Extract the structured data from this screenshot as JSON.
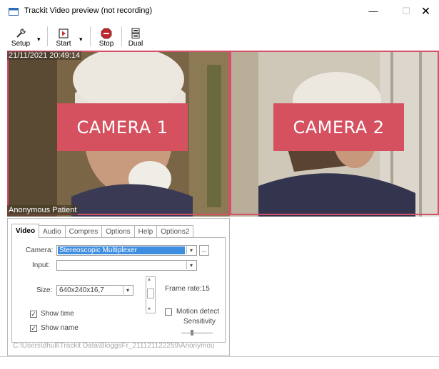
{
  "window": {
    "title": "Trackit Video preview (not recording)",
    "minimize_glyph": "—",
    "maximize_glyph": "☐",
    "close_glyph": "✕"
  },
  "toolbar": {
    "setup_label": "Setup",
    "start_label": "Start",
    "stop_label": "Stop",
    "dual_label": "Dual",
    "dropdown_arrow": "▾"
  },
  "video": {
    "timestamp": "21/11/2021 20:49:14",
    "patient_name": "Anonymous Patient",
    "camera1_label": "CAMERA 1",
    "camera2_label": "CAMERA 2"
  },
  "settings": {
    "tabs": [
      {
        "label": "Video"
      },
      {
        "label": "Audio"
      },
      {
        "label": "Compres"
      },
      {
        "label": "Options"
      },
      {
        "label": "Help"
      },
      {
        "label": "Options2"
      }
    ],
    "camera_label": "Camera:",
    "camera_value": "Stereoscopic Multiplexer",
    "browse_label": "...",
    "input_label": "Input:",
    "input_value": "",
    "size_label": "Size:",
    "size_value": "640x240x16,7",
    "frame_rate_text": "Frame rate:15",
    "show_time_label": "Show time",
    "show_time_checked": true,
    "show_name_label": "Show name",
    "show_name_checked": true,
    "motion_detect_label": "Motion detect",
    "motion_detect_checked": false,
    "sensitivity_label": "Sensitivity",
    "check_glyph": "✓",
    "dd_glyph": "▾",
    "spin_up_glyph": "▴",
    "spin_down_glyph": "▾"
  },
  "path": "C:\\Users\\dhull\\Trackit Data\\BloggsFr_211121122259\\Anonymou",
  "colors": {
    "camera_label_bg": "#d5515f",
    "camera_border": "#d5516a",
    "selection_blue": "#3d8de0"
  }
}
